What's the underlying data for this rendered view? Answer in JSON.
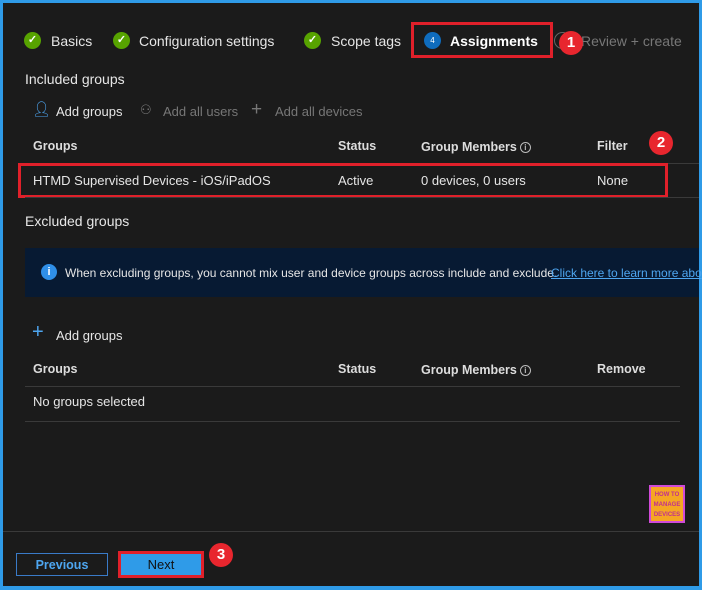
{
  "steps": [
    {
      "label": "Basics",
      "state": "done"
    },
    {
      "label": "Configuration settings",
      "state": "done"
    },
    {
      "label": "Scope tags",
      "state": "done"
    },
    {
      "label": "Assignments",
      "state": "current",
      "number": "4"
    },
    {
      "label": "Review + create",
      "state": "pending"
    }
  ],
  "included": {
    "title": "Included groups",
    "actions": {
      "add_groups": "Add groups",
      "add_all_users": "Add all users",
      "add_all_devices": "Add all devices"
    },
    "columns": [
      "Groups",
      "Status",
      "Group Members",
      "Filter"
    ],
    "rows": [
      {
        "group": "HTMD Supervised Devices - iOS/iPadOS",
        "status": "Active",
        "members": "0 devices, 0 users",
        "filter": "None"
      }
    ]
  },
  "excluded": {
    "title": "Excluded groups",
    "info_text": "When excluding groups, you cannot mix user and device groups across include and exclude.",
    "info_link": "Click here to learn more abo",
    "add_groups": "Add groups",
    "columns": [
      "Groups",
      "Status",
      "Group Members",
      "Remove"
    ],
    "empty": "No groups selected"
  },
  "footer": {
    "previous": "Previous",
    "next": "Next"
  },
  "annotations": [
    "1",
    "2",
    "3"
  ],
  "logo": {
    "line1": "HOW TO",
    "line2": "MANAGE",
    "line3": "DEVICES"
  },
  "colors": {
    "accent": "#2f9be8",
    "check": "#57a300",
    "highlight": "#e0202a",
    "info_bg": "#071a33",
    "link": "#4ea6f0"
  }
}
